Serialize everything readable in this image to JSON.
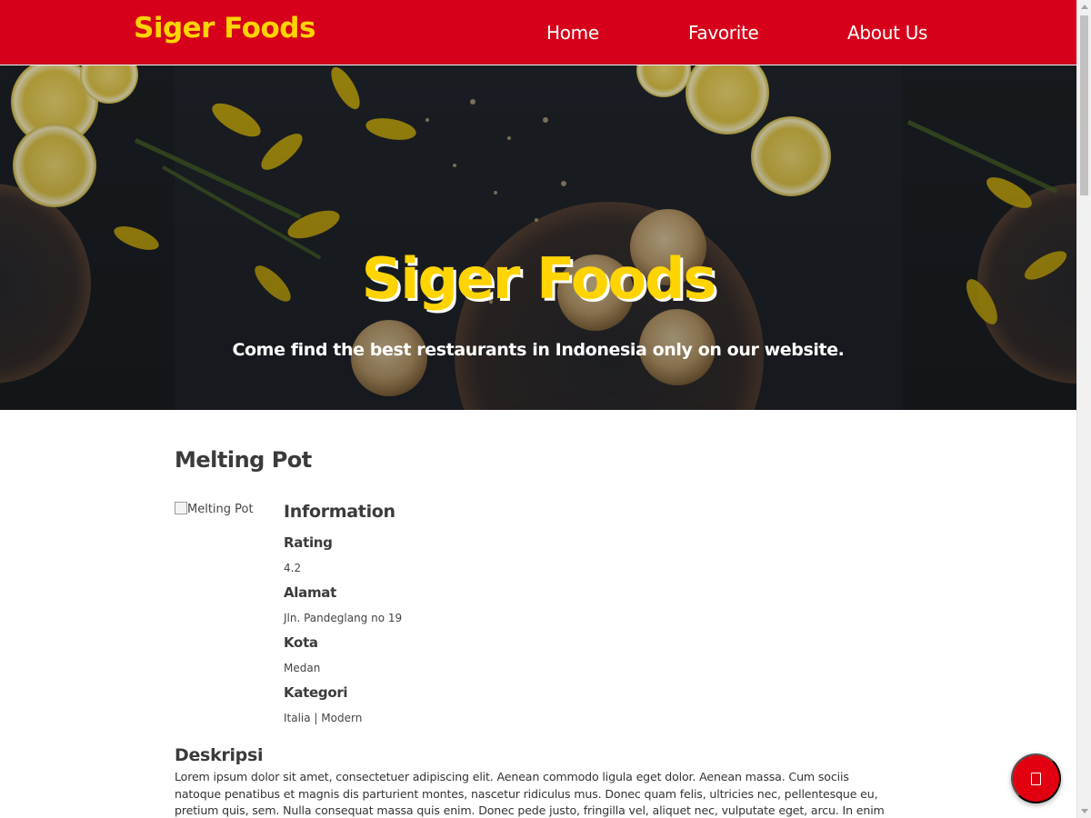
{
  "header": {
    "brand": "Siger Foods",
    "nav": [
      "Home",
      "Favorite",
      "About Us"
    ]
  },
  "hero": {
    "title": "Siger Foods",
    "subtitle": "Come find the best restaurants in Indonesia only on our website."
  },
  "restaurant": {
    "name": "Melting Pot",
    "image_alt": "Melting Pot",
    "info_heading": "Information",
    "rating_label": "Rating",
    "rating_value": "4.2",
    "address_label": "Alamat",
    "address_value": "Jln. Pandeglang no 19",
    "city_label": "Kota",
    "city_value": "Medan",
    "category_label": "Kategori",
    "category_value": "Italia | Modern",
    "description_heading": "Deskripsi",
    "description": "Lorem ipsum dolor sit amet, consectetuer adipiscing elit. Aenean commodo ligula eget dolor. Aenean massa. Cum sociis natoque penatibus et magnis dis parturient montes, nascetur ridiculus mus. Donec quam felis, ultricies nec, pellentesque eu, pretium quis, sem. Nulla consequat massa quis enim. Donec pede justo, fringilla vel, aliquet nec, vulputate eget, arcu. In enim justo, rhoncus ut,"
  },
  "fab": {
    "icon": "favorite-icon"
  },
  "colors": {
    "header_red": "#d7001a",
    "brand_yellow": "#ffd400",
    "fab_red": "#e20010"
  }
}
